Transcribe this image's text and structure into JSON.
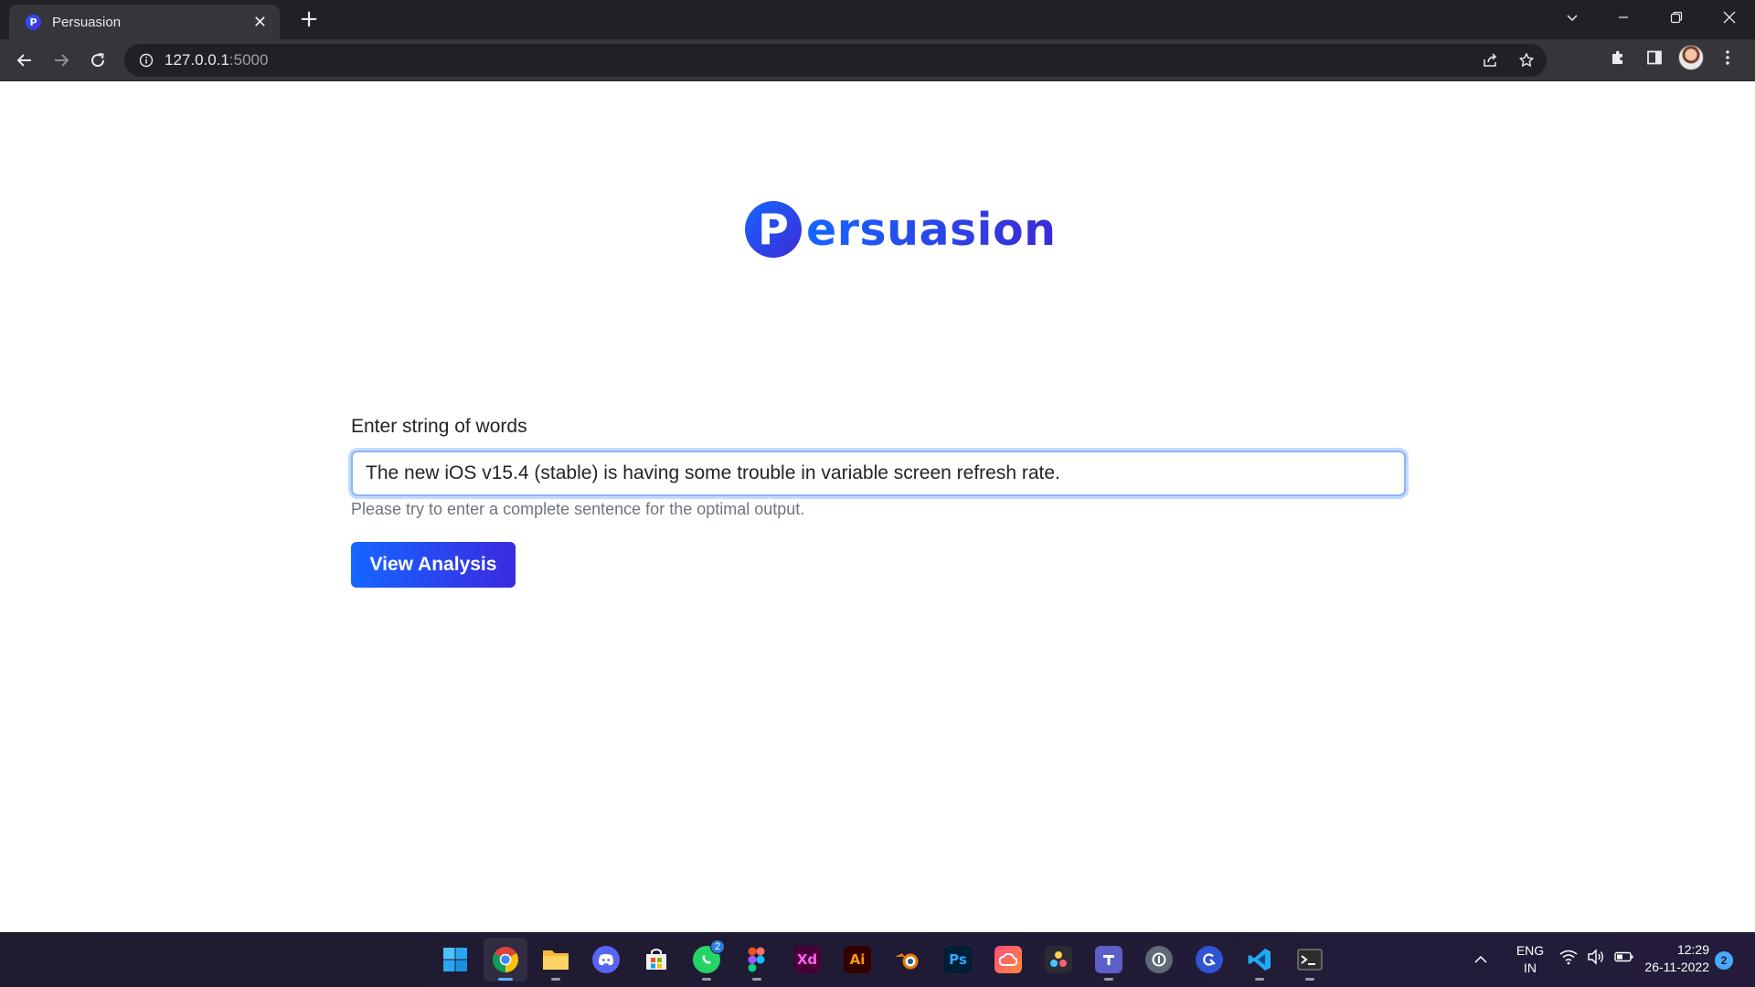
{
  "browser": {
    "tab_title": "Persuasion",
    "tab_favicon_letter": "P",
    "close_glyph": "✕",
    "new_tab_glyph": "+",
    "url_host": "127.0.0.1",
    "url_port": ":5000"
  },
  "page": {
    "logo_mark": "P",
    "logo_text": "ersuasion",
    "brand_color": "#1f5cff",
    "accent_color": "#3d2ad6",
    "input_label": "Enter string of words",
    "input_value": "The new iOS v15.4 (stable) is having some trouble in variable screen refresh rate.",
    "hint": "Please try to enter a complete sentence for the optimal output.",
    "submit_label": "View Analysis"
  },
  "taskbar": {
    "apps": [
      {
        "name": "start-icon",
        "active": false
      },
      {
        "name": "chrome-icon",
        "active": true
      },
      {
        "name": "file-explorer-icon",
        "active": false
      },
      {
        "name": "discord-icon",
        "active": false
      },
      {
        "name": "microsoft-store-icon",
        "active": false
      },
      {
        "name": "whatsapp-icon",
        "active": false,
        "badge": "2"
      },
      {
        "name": "figma-icon",
        "active": false
      },
      {
        "name": "adobe-xd-icon",
        "active": false,
        "label": "Xd"
      },
      {
        "name": "adobe-illustrator-icon",
        "active": false,
        "label": "Ai"
      },
      {
        "name": "blender-icon",
        "active": false
      },
      {
        "name": "adobe-photoshop-icon",
        "active": false,
        "label": "Ps"
      },
      {
        "name": "creative-cloud-icon",
        "active": false
      },
      {
        "name": "davinci-resolve-icon",
        "active": false
      },
      {
        "name": "teams-icon",
        "active": false
      },
      {
        "name": "sync-icon",
        "active": false
      },
      {
        "name": "search-app-icon",
        "active": false
      },
      {
        "name": "vscode-icon",
        "active": false
      },
      {
        "name": "terminal-icon",
        "active": false
      }
    ],
    "lang_line1": "ENG",
    "lang_line2": "IN",
    "time": "12:29",
    "date": "26-11-2022",
    "notification_count": "2"
  }
}
